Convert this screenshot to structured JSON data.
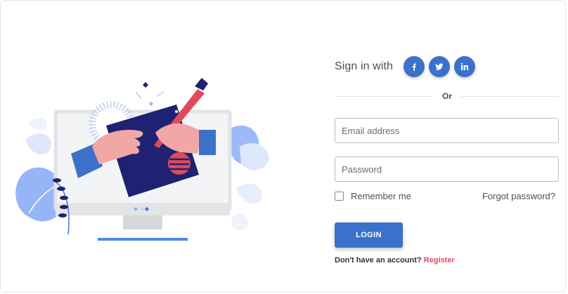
{
  "illustration": {
    "name": "login-illustration"
  },
  "signin": {
    "label": "Sign in with",
    "social": [
      {
        "icon": "facebook-icon",
        "glyph": "f"
      },
      {
        "icon": "twitter-icon",
        "glyph": "bird"
      },
      {
        "icon": "linkedin-icon",
        "glyph": "in"
      }
    ]
  },
  "divider": {
    "text": "Or"
  },
  "form": {
    "email_placeholder": "Email address",
    "password_placeholder": "Password",
    "remember_label": "Remember me",
    "remember_checked": false,
    "forgot_label": "Forgot password?",
    "login_label": "LOGIN"
  },
  "register": {
    "prompt": "Don't have an account?",
    "link": "Register"
  },
  "colors": {
    "primary": "#3b71ca",
    "danger": "#dc4c64",
    "border": "#bdbdbd"
  }
}
